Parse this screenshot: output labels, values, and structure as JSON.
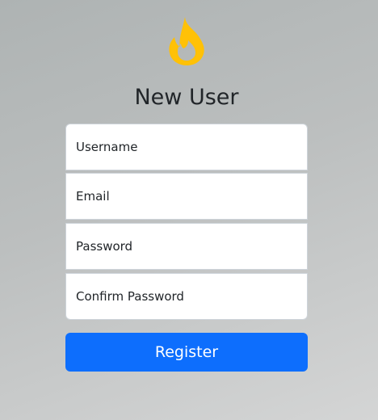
{
  "logo": {
    "icon": "flame-icon",
    "color": "#ffc107"
  },
  "form": {
    "title": "New User",
    "fields": [
      {
        "placeholder": "Username",
        "value": ""
      },
      {
        "placeholder": "Email",
        "value": ""
      },
      {
        "placeholder": "Password",
        "value": ""
      },
      {
        "placeholder": "Confirm Password",
        "value": ""
      }
    ],
    "submit_label": "Register",
    "accent_color": "#0d6efd"
  }
}
